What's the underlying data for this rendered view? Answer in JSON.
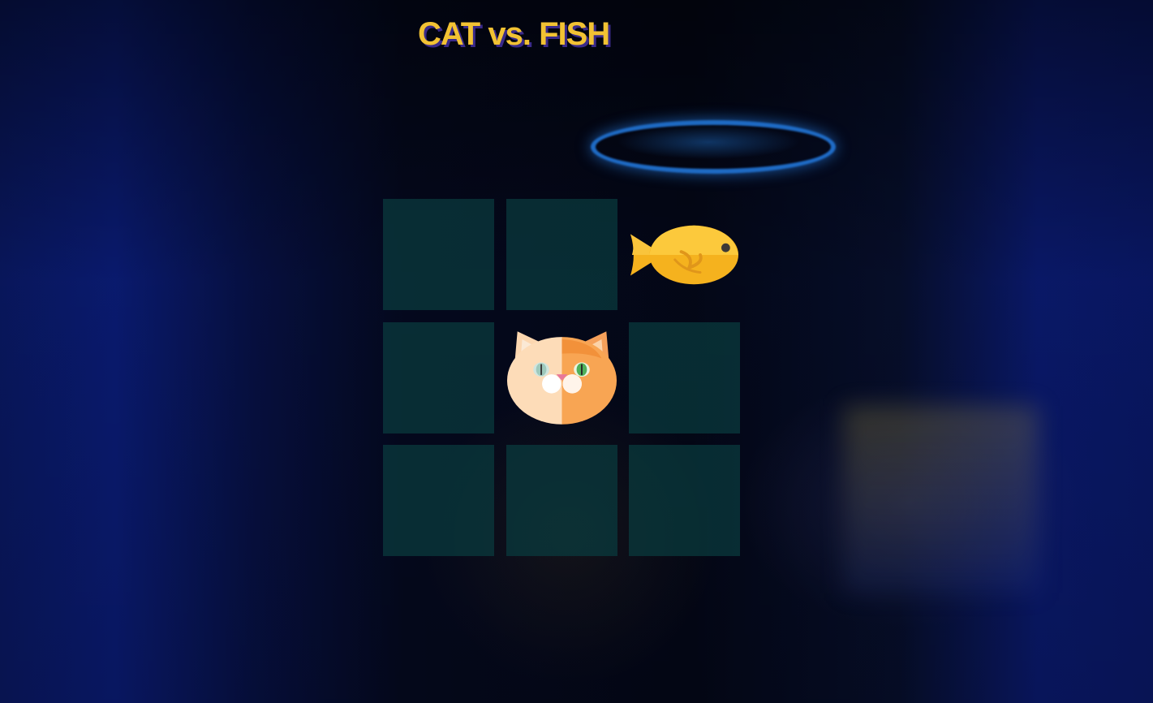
{
  "title": "CAT vs. FISH",
  "colors": {
    "title": "#f2c233",
    "title_shadow": "#3a2a8a",
    "cell": "#0a3c3e"
  },
  "board": {
    "cells": [
      {
        "row": 1,
        "col": 1,
        "piece": ""
      },
      {
        "row": 1,
        "col": 2,
        "piece": ""
      },
      {
        "row": 1,
        "col": 3,
        "piece": "fish-icon"
      },
      {
        "row": 2,
        "col": 1,
        "piece": ""
      },
      {
        "row": 2,
        "col": 2,
        "piece": "cat-icon"
      },
      {
        "row": 2,
        "col": 3,
        "piece": ""
      },
      {
        "row": 3,
        "col": 1,
        "piece": ""
      },
      {
        "row": 3,
        "col": 2,
        "piece": ""
      },
      {
        "row": 3,
        "col": 3,
        "piece": ""
      }
    ]
  }
}
